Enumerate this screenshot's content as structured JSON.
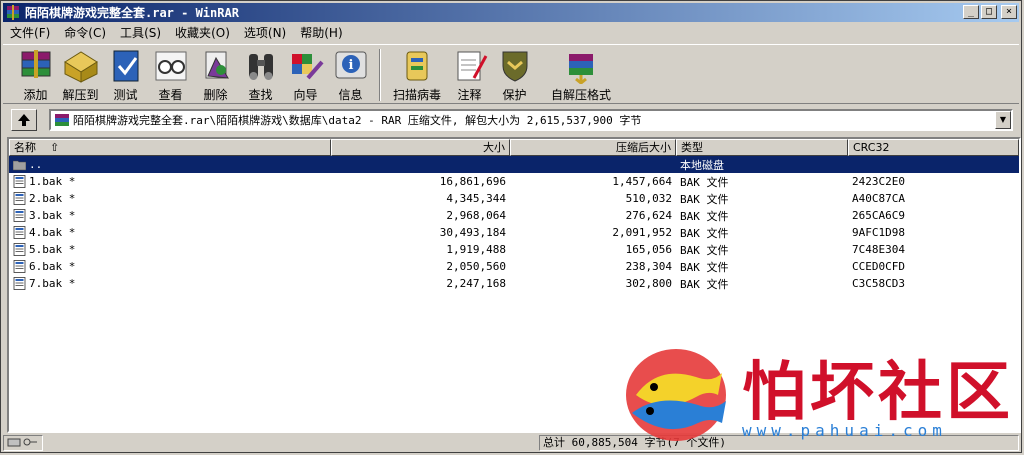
{
  "window": {
    "title": "陌陌棋牌游戏完整全套.rar - WinRAR",
    "buttons": [
      "_",
      "□",
      "×"
    ]
  },
  "menu": [
    {
      "label": "文件",
      "key": "(F)"
    },
    {
      "label": "命令",
      "key": "(C)"
    },
    {
      "label": "工具",
      "key": "(S)"
    },
    {
      "label": "收藏夹",
      "key": "(O)"
    },
    {
      "label": "选项",
      "key": "(N)"
    },
    {
      "label": "帮助",
      "key": "(H)"
    }
  ],
  "toolbar": [
    {
      "label": "添加",
      "icon": "add-books-icon"
    },
    {
      "label": "解压到",
      "icon": "extract-to-icon"
    },
    {
      "label": "测试",
      "icon": "test-icon"
    },
    {
      "label": "查看",
      "icon": "view-glasses-icon"
    },
    {
      "label": "删除",
      "icon": "delete-icon"
    },
    {
      "label": "查找",
      "icon": "binoculars-icon"
    },
    {
      "label": "向导",
      "icon": "wizard-icon"
    },
    {
      "label": "信息",
      "icon": "info-icon"
    },
    {
      "label": "扫描病毒",
      "icon": "scan-virus-icon"
    },
    {
      "label": "注释",
      "icon": "comment-icon"
    },
    {
      "label": "保护",
      "icon": "protect-shield-icon"
    },
    {
      "label": "自解压格式",
      "icon": "sfx-icon"
    }
  ],
  "address": {
    "path": "陌陌棋牌游戏完整全套.rar\\陌陌棋牌游戏\\数据库\\data2 - RAR 压缩文件, 解包大小为 2,615,537,900 字节"
  },
  "columns": [
    "名称",
    "大小",
    "压缩后大小",
    "类型",
    "CRC32"
  ],
  "parent_row": {
    "name": "..",
    "type": "本地磁盘"
  },
  "files": [
    {
      "name": "1.bak *",
      "size": "16,861,696",
      "packed": "1,457,664",
      "type": "BAK 文件",
      "crc": "2423C2E0"
    },
    {
      "name": "2.bak *",
      "size": "4,345,344",
      "packed": "510,032",
      "type": "BAK 文件",
      "crc": "A40C87CA"
    },
    {
      "name": "3.bak *",
      "size": "2,968,064",
      "packed": "276,624",
      "type": "BAK 文件",
      "crc": "265CA6C9"
    },
    {
      "name": "4.bak *",
      "size": "30,493,184",
      "packed": "2,091,952",
      "type": "BAK 文件",
      "crc": "9AFC1D98"
    },
    {
      "name": "5.bak *",
      "size": "1,919,488",
      "packed": "165,056",
      "type": "BAK 文件",
      "crc": "7C48E304"
    },
    {
      "name": "6.bak *",
      "size": "2,050,560",
      "packed": "238,304",
      "type": "BAK 文件",
      "crc": "CCED0CFD"
    },
    {
      "name": "7.bak *",
      "size": "2,247,168",
      "packed": "302,800",
      "type": "BAK 文件",
      "crc": "C3C58CD3"
    }
  ],
  "status": {
    "total": "总计 60,885,504 字节(7 个文件)"
  },
  "watermark": {
    "text": "怕坏社区",
    "url": "www.pahuai.com"
  }
}
